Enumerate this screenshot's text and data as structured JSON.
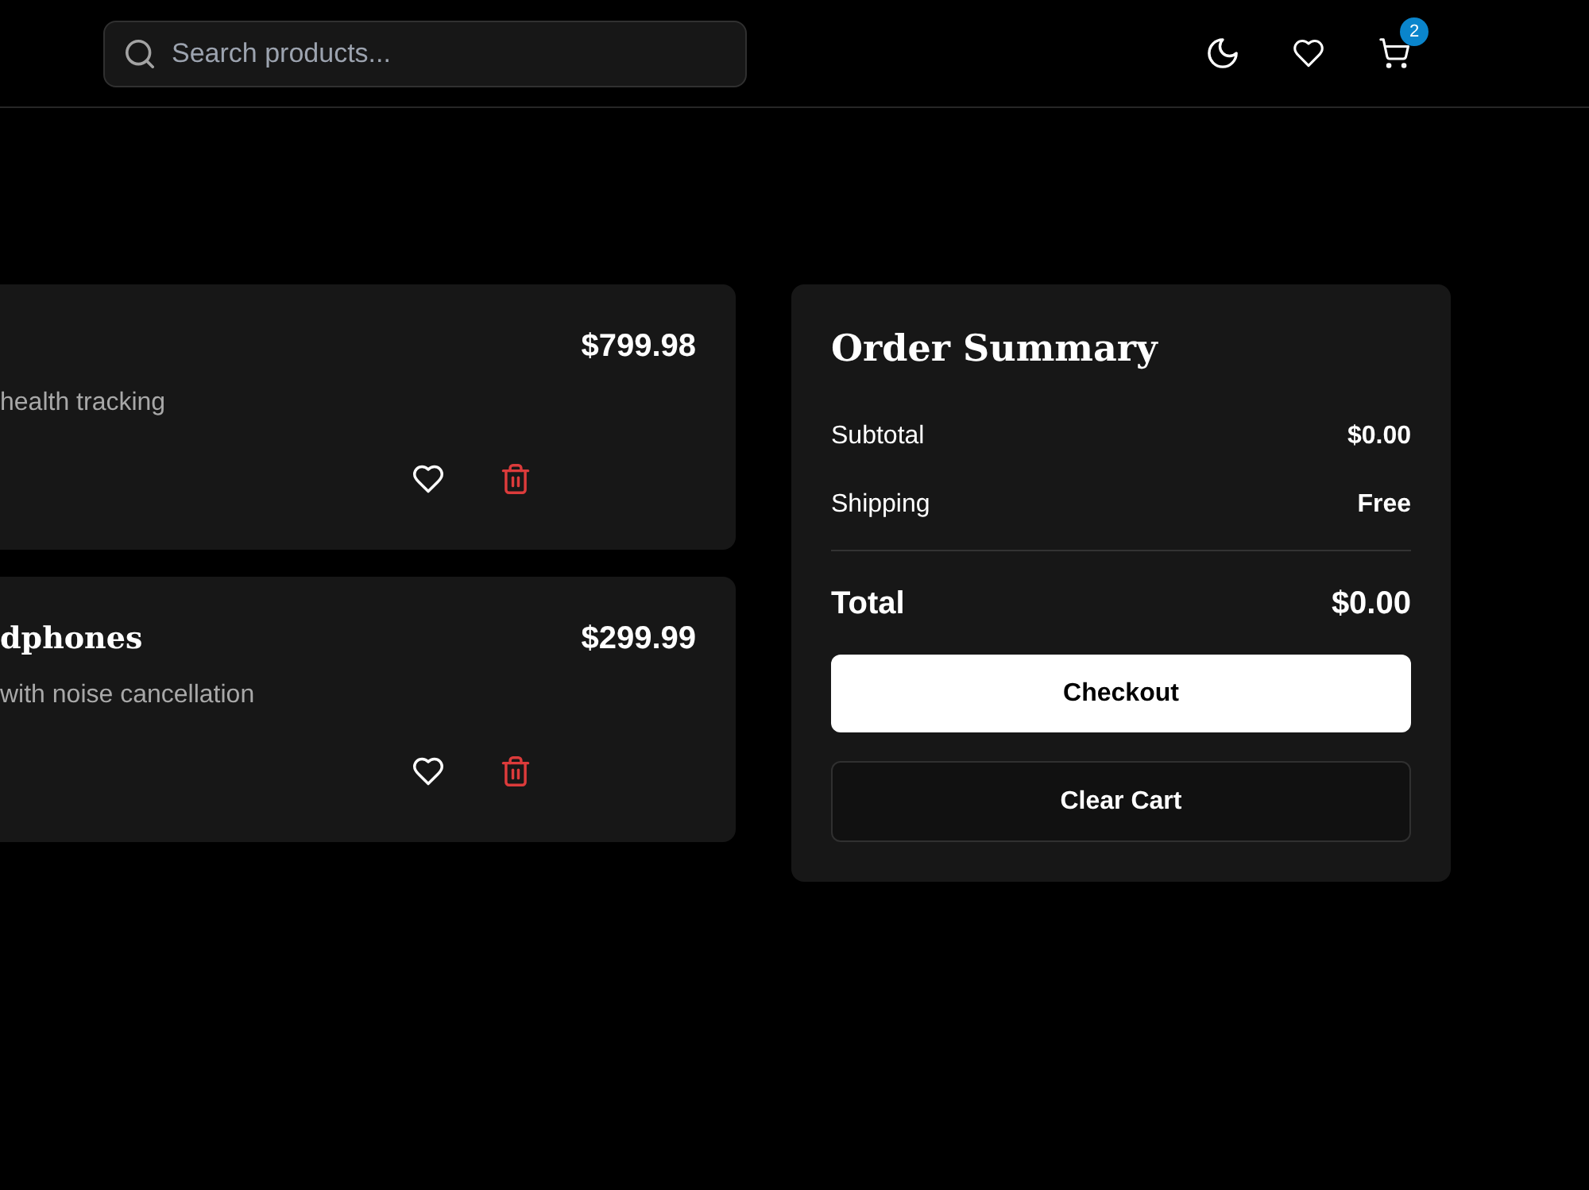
{
  "header": {
    "search": {
      "placeholder": "Search products..."
    },
    "cart_badge": "2"
  },
  "cart_items": [
    {
      "price": "$799.98",
      "description": "health tracking"
    },
    {
      "title": "dphones",
      "price": "$299.99",
      "description": "with noise cancellation"
    }
  ],
  "summary": {
    "title": "Order Summary",
    "rows": [
      {
        "label": "Subtotal",
        "value": "$0.00"
      },
      {
        "label": "Shipping",
        "value": "Free"
      }
    ],
    "total": {
      "label": "Total",
      "value": "$0.00"
    },
    "buttons": [
      {
        "label": "Checkout",
        "kind": "primary"
      },
      {
        "label": "Clear Cart",
        "kind": "outline"
      }
    ]
  }
}
